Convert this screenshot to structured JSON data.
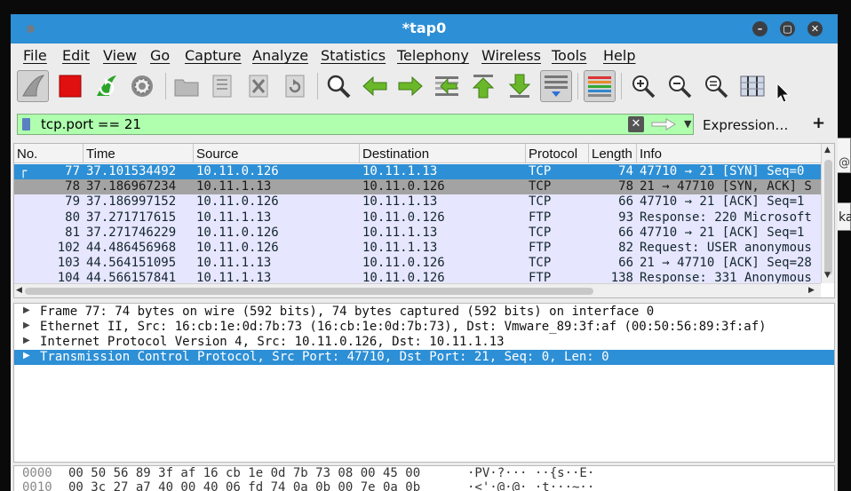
{
  "window": {
    "title": "*tap0"
  },
  "menu": [
    "File",
    "Edit",
    "View",
    "Go",
    "Capture",
    "Analyze",
    "Statistics",
    "Telephony",
    "Wireless",
    "Tools",
    "Help"
  ],
  "filter": {
    "value": "tcp.port == 21",
    "expression_label": "Expression…",
    "add_label": "+"
  },
  "columns": [
    "No.",
    "Time",
    "Source",
    "Destination",
    "Protocol",
    "Length",
    "Info"
  ],
  "packets": [
    {
      "no": "77",
      "time": "37.101534492",
      "src": "10.11.0.126",
      "dst": "10.11.1.13",
      "proto": "TCP",
      "len": "74",
      "info": "47710 → 21 [SYN] Seq=0"
    },
    {
      "no": "78",
      "time": "37.186967234",
      "src": "10.11.1.13",
      "dst": "10.11.0.126",
      "proto": "TCP",
      "len": "78",
      "info": "21 → 47710 [SYN, ACK] S"
    },
    {
      "no": "79",
      "time": "37.186997152",
      "src": "10.11.0.126",
      "dst": "10.11.1.13",
      "proto": "TCP",
      "len": "66",
      "info": "47710 → 21 [ACK] Seq=1"
    },
    {
      "no": "80",
      "time": "37.271717615",
      "src": "10.11.1.13",
      "dst": "10.11.0.126",
      "proto": "FTP",
      "len": "93",
      "info": "Response: 220 Microsoft"
    },
    {
      "no": "81",
      "time": "37.271746229",
      "src": "10.11.0.126",
      "dst": "10.11.1.13",
      "proto": "TCP",
      "len": "66",
      "info": "47710 → 21 [ACK] Seq=1"
    },
    {
      "no": "102",
      "time": "44.486456968",
      "src": "10.11.0.126",
      "dst": "10.11.1.13",
      "proto": "FTP",
      "len": "82",
      "info": "Request: USER anonymous"
    },
    {
      "no": "103",
      "time": "44.564151095",
      "src": "10.11.1.13",
      "dst": "10.11.0.126",
      "proto": "TCP",
      "len": "66",
      "info": "21 → 47710 [ACK] Seq=28"
    },
    {
      "no": "104",
      "time": "44.566157841",
      "src": "10.11.1.13",
      "dst": "10.11.0.126",
      "proto": "FTP",
      "len": "138",
      "info": "Response: 331 Anonymous"
    }
  ],
  "details": [
    "Frame 77: 74 bytes on wire (592 bits), 74 bytes captured (592 bits) on interface 0",
    "Ethernet II, Src: 16:cb:1e:0d:7b:73 (16:cb:1e:0d:7b:73), Dst: Vmware_89:3f:af (00:50:56:89:3f:af)",
    "Internet Protocol Version 4, Src: 10.11.0.126, Dst: 10.11.1.13",
    "Transmission Control Protocol, Src Port: 47710, Dst Port: 21, Seq: 0, Len: 0"
  ],
  "bytes": [
    {
      "offset": "0000",
      "hex": "00 50 56 89 3f af 16 cb  1e 0d 7b 73 08 00 45 00",
      "ascii": "·PV·?···  ··{s··E·"
    },
    {
      "offset": "0010",
      "hex": "00 3c 27 a7 40 00 40 06  fd 74 0a 0b 00 7e 0a 0b",
      "ascii": "·<'·@·@·  ·t···~··"
    }
  ],
  "desktop": {
    "peek_top": "@",
    "peek_bottom": "ka"
  },
  "colors": {
    "titlebar": "#2d8fd5",
    "selection": "#2d8fd5",
    "filter_valid": "#afffaf",
    "tcp_row": "#e7e6ff"
  }
}
